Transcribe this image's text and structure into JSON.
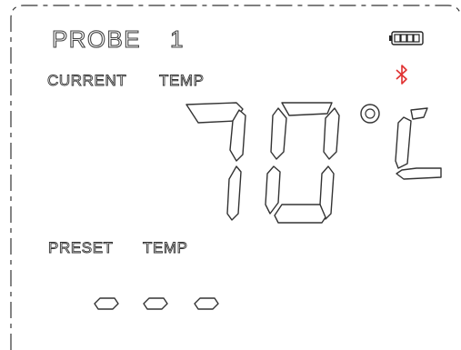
{
  "probe": {
    "label": "PROBE",
    "number": "1"
  },
  "current": {
    "label_word": "CURRENT",
    "label_temp": "TEMP",
    "value": "70",
    "unit": "°C"
  },
  "preset": {
    "label_word": "PRESET",
    "label_temp": "TEMP",
    "value": "---"
  },
  "status": {
    "battery_icon": "battery-icon",
    "bluetooth_icon": "bluetooth-icon",
    "bluetooth_color": "#e03030",
    "battery_level": 1.0
  }
}
